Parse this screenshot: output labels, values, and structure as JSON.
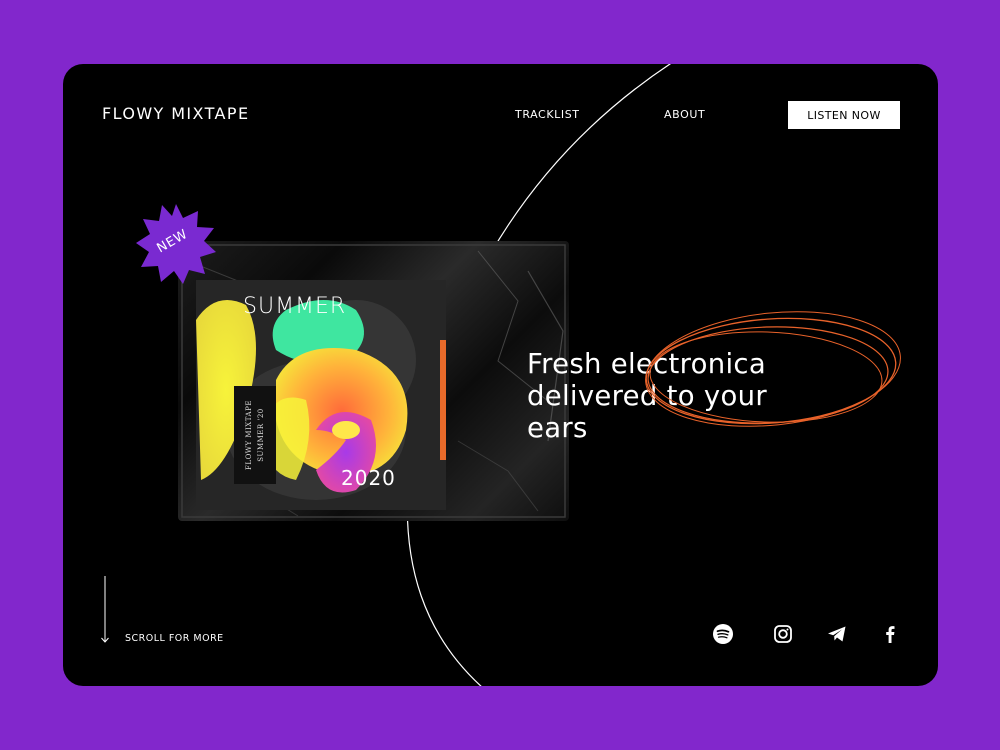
{
  "header": {
    "logo": "FLOWY MIXTAPE",
    "nav": {
      "tracklist": "TRACKLIST",
      "about": "ABOUT"
    },
    "cta": "LISTEN NOW"
  },
  "album": {
    "badge": "NEW",
    "title": "SUMMER",
    "year": "2020",
    "spine_line1": "FLOWY MIXTAPE",
    "spine_line2": "SUMMER '20"
  },
  "hero": {
    "headline_lines": [
      "Fresh electronica",
      "delivered to your",
      "ears"
    ],
    "scribble_color": "#e8622a"
  },
  "footer": {
    "scroll_text": "SCROLL FOR MORE",
    "social_icons": [
      "spotify-icon",
      "instagram-icon",
      "telegram-icon",
      "facebook-icon"
    ]
  },
  "colors": {
    "background": "#8227cc",
    "card": "#000000",
    "badge": "#7a2ad1",
    "accent": "#e8622a"
  }
}
